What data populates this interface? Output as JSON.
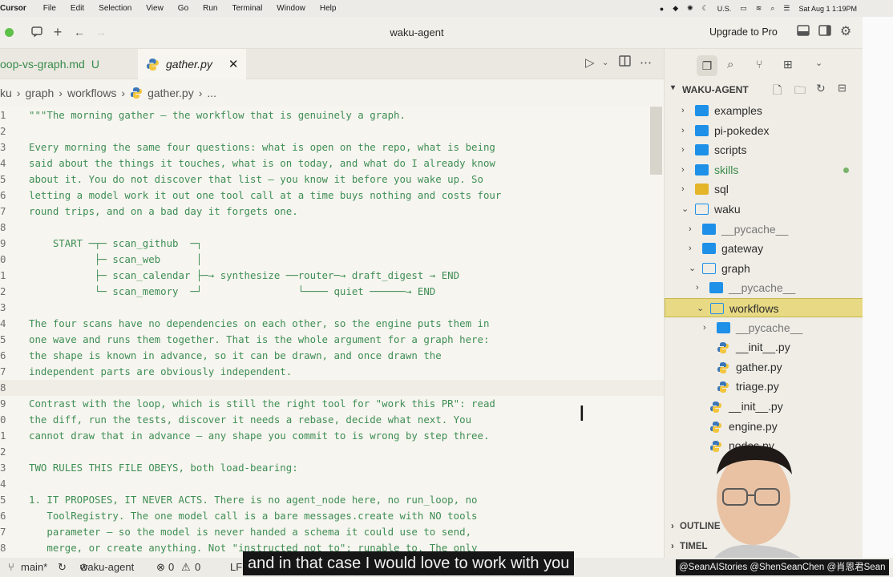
{
  "menubar": {
    "app": "Cursor",
    "items": [
      "File",
      "Edit",
      "Selection",
      "View",
      "Go",
      "Run",
      "Terminal",
      "Window",
      "Help"
    ],
    "input_source": "U.S.",
    "datetime": "Sat Aug 1  1:19PM"
  },
  "titlebar": {
    "title": "waku-agent",
    "upgrade_label": "Upgrade to Pro"
  },
  "tabs": [
    {
      "label": "oop-vs-graph.md",
      "badge": "U"
    },
    {
      "label": "gather.py"
    }
  ],
  "breadcrumb": [
    "ku",
    "graph",
    "workflows",
    "gather.py",
    "..."
  ],
  "editor": {
    "lines": [
      {
        "n": "1",
        "text": "\"\"\"The morning gather — the workflow that is genuinely a graph."
      },
      {
        "n": "2",
        "text": ""
      },
      {
        "n": "3",
        "text": "Every morning the same four questions: what is open on the repo, what is being"
      },
      {
        "n": "4",
        "text": "said about the things it touches, what is on today, and what do I already know"
      },
      {
        "n": "5",
        "text": "about it. You do not discover that list — you know it before you wake up. So"
      },
      {
        "n": "6",
        "text": "letting a model work it out one tool call at a time buys nothing and costs four"
      },
      {
        "n": "7",
        "text": "round trips, and on a bad day it forgets one."
      },
      {
        "n": "8",
        "text": ""
      },
      {
        "n": "9",
        "text": "    START ─┬─ scan_github  ─┐"
      },
      {
        "n": "0",
        "text": "           ├─ scan_web      │"
      },
      {
        "n": "1",
        "text": "           ├─ scan_calendar ├─→ synthesize ──router─→ draft_digest → END"
      },
      {
        "n": "2",
        "text": "           └─ scan_memory  ─┘                └──── quiet ──────→ END"
      },
      {
        "n": "3",
        "text": ""
      },
      {
        "n": "4",
        "text": "The four scans have no dependencies on each other, so the engine puts them in"
      },
      {
        "n": "5",
        "text": "one wave and runs them together. That is the whole argument for a graph here:"
      },
      {
        "n": "6",
        "text": "the shape is known in advance, so it can be drawn, and once drawn the"
      },
      {
        "n": "7",
        "text": "independent parts are obviously independent."
      },
      {
        "n": "8",
        "text": ""
      },
      {
        "n": "9",
        "text": "Contrast with the loop, which is still the right tool for \"work this PR\": read"
      },
      {
        "n": "0",
        "text": "the diff, run the tests, discover it needs a rebase, decide what next. You"
      },
      {
        "n": "1",
        "text": "cannot draw that in advance — any shape you commit to is wrong by step three."
      },
      {
        "n": "2",
        "text": ""
      },
      {
        "n": "3",
        "text": "TWO RULES THIS FILE OBEYS, both load-bearing:"
      },
      {
        "n": "4",
        "text": ""
      },
      {
        "n": "5",
        "text": "1. IT PROPOSES, IT NEVER ACTS. There is no agent_node here, no run_loop, no"
      },
      {
        "n": "6",
        "text": "   ToolRegistry. The one model call is a bare messages.create with NO tools"
      },
      {
        "n": "7",
        "text": "   parameter — so the model is never handed a schema it could use to send,"
      },
      {
        "n": "8",
        "text": "   merge, or create anything. Not \"instructed not to\": runable to. The only"
      }
    ]
  },
  "explorer": {
    "header": "WAKU-AGENT",
    "items": [
      {
        "label": "examples",
        "depth": 0,
        "kind": "folder",
        "open": false
      },
      {
        "label": "pi-pokedex",
        "depth": 0,
        "kind": "folder",
        "open": false
      },
      {
        "label": "scripts",
        "depth": 0,
        "kind": "folder",
        "open": false
      },
      {
        "label": "skills",
        "depth": 0,
        "kind": "folder",
        "open": false,
        "modified": true
      },
      {
        "label": "sql",
        "depth": 0,
        "kind": "sql",
        "open": false
      },
      {
        "label": "waku",
        "depth": 0,
        "kind": "folder",
        "open": true
      },
      {
        "label": "__pycache__",
        "depth": 1,
        "kind": "folder",
        "open": false,
        "dim": true
      },
      {
        "label": "gateway",
        "depth": 1,
        "kind": "folder",
        "open": false
      },
      {
        "label": "graph",
        "depth": 1,
        "kind": "folder",
        "open": true
      },
      {
        "label": "__pycache__",
        "depth": 2,
        "kind": "folder",
        "open": false,
        "dim": true
      },
      {
        "label": "workflows",
        "depth": 2,
        "kind": "folder",
        "open": true,
        "selected": true
      },
      {
        "label": "__pycache__",
        "depth": 3,
        "kind": "folder",
        "open": false,
        "dim": true
      },
      {
        "label": "__init__.py",
        "depth": 3,
        "kind": "py"
      },
      {
        "label": "gather.py",
        "depth": 3,
        "kind": "py"
      },
      {
        "label": "triage.py",
        "depth": 3,
        "kind": "py"
      },
      {
        "label": "__init__.py",
        "depth": 2,
        "kind": "py"
      },
      {
        "label": "engine.py",
        "depth": 2,
        "kind": "py"
      },
      {
        "label": "nodes.py",
        "depth": 2,
        "kind": "py"
      }
    ],
    "outline_label": "OUTLINE",
    "timeline_label": "TIMEL"
  },
  "statusbar": {
    "branch": "main*",
    "project": "waku-agent",
    "errors": "0",
    "warnings": "0",
    "eol": "LF"
  },
  "caption": "and in that case I would love to work with you",
  "handles": "@SeanAIStories @ShenSeanChen @肖恩君Sean",
  "colors": {
    "accent_folder": "#1e90e8",
    "selection": "#e8d984",
    "code_green": "#3e8e55"
  }
}
